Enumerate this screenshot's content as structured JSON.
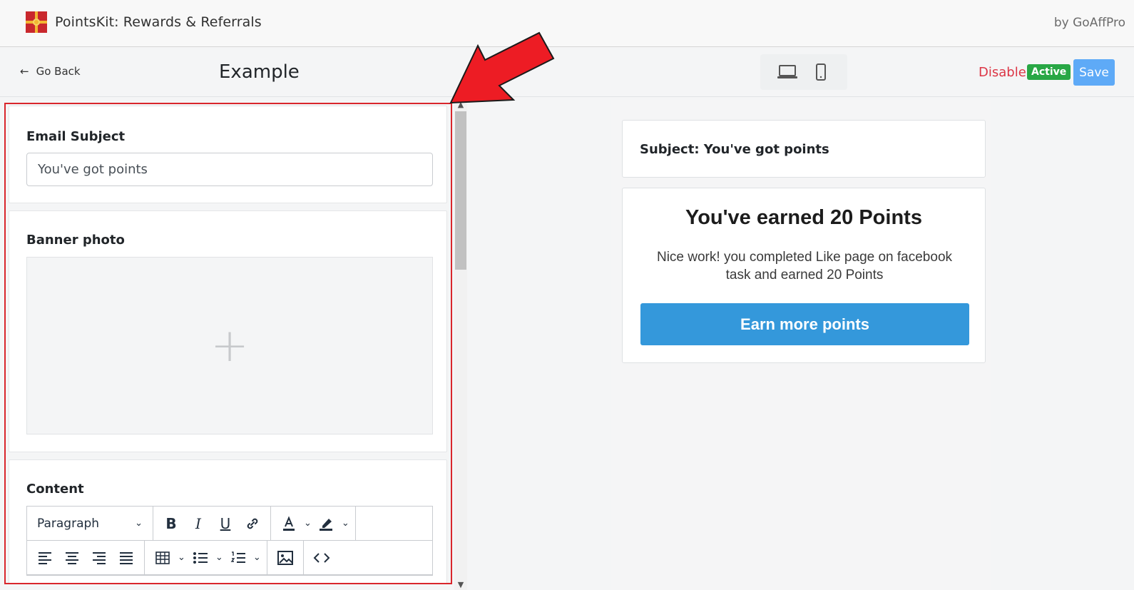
{
  "app": {
    "title": "PointsKit: Rewards & Referrals",
    "by_line": "by GoAffPro"
  },
  "toolbar": {
    "back_label": "Go Back",
    "page_title": "Example",
    "devices": [
      "laptop-icon",
      "mobile-icon"
    ],
    "disable_label": "Disable",
    "status_badge": "Active",
    "save_label": "Save"
  },
  "editor": {
    "email_subject_label": "Email Subject",
    "email_subject_value": "You've got points",
    "banner_label": "Banner photo",
    "content_label": "Content",
    "block_format": "Paragraph",
    "toolbar_icons_row1": [
      "bold-icon",
      "italic-icon",
      "underline-icon",
      "link-icon",
      "text-color-icon",
      "highlight-icon"
    ],
    "toolbar_icons_row2": [
      "align-left-icon",
      "align-center-icon",
      "align-right-icon",
      "align-justify-icon",
      "table-icon",
      "bullet-list-icon",
      "numbered-list-icon",
      "image-icon",
      "source-code-icon"
    ]
  },
  "preview": {
    "subject_line": "Subject: You've got points",
    "heading": "You've earned 20 Points",
    "body": "Nice work! you completed Like page on facebook task and earned 20 Points",
    "cta_label": "Earn more points"
  },
  "colors": {
    "accent_save": "#5eaaf7",
    "disable_red": "#dc3545",
    "active_green": "#28a745",
    "cta_blue": "#3498db",
    "highlight_red": "#d9262c"
  }
}
